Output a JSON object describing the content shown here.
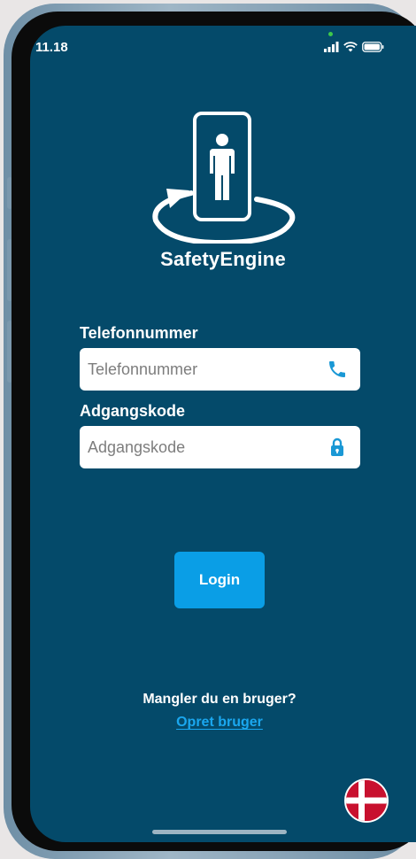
{
  "status_bar": {
    "time": "11.18"
  },
  "brand": {
    "name": "SafetyEngine"
  },
  "form": {
    "phone_label": "Telefonnummer",
    "phone_placeholder": "Telefonnummer",
    "password_label": "Adgangskode",
    "password_placeholder": "Adgangskode"
  },
  "login_button": "Login",
  "signup": {
    "prompt": "Mangler du en bruger?",
    "link": "Opret bruger"
  },
  "colors": {
    "background": "#044a6a",
    "accent": "#0a9ee6",
    "link": "#1aa7ef",
    "flag_red": "#c8102e"
  },
  "icons": {
    "phone": "phone-icon",
    "lock": "lock-icon",
    "language": "denmark-flag-icon"
  }
}
